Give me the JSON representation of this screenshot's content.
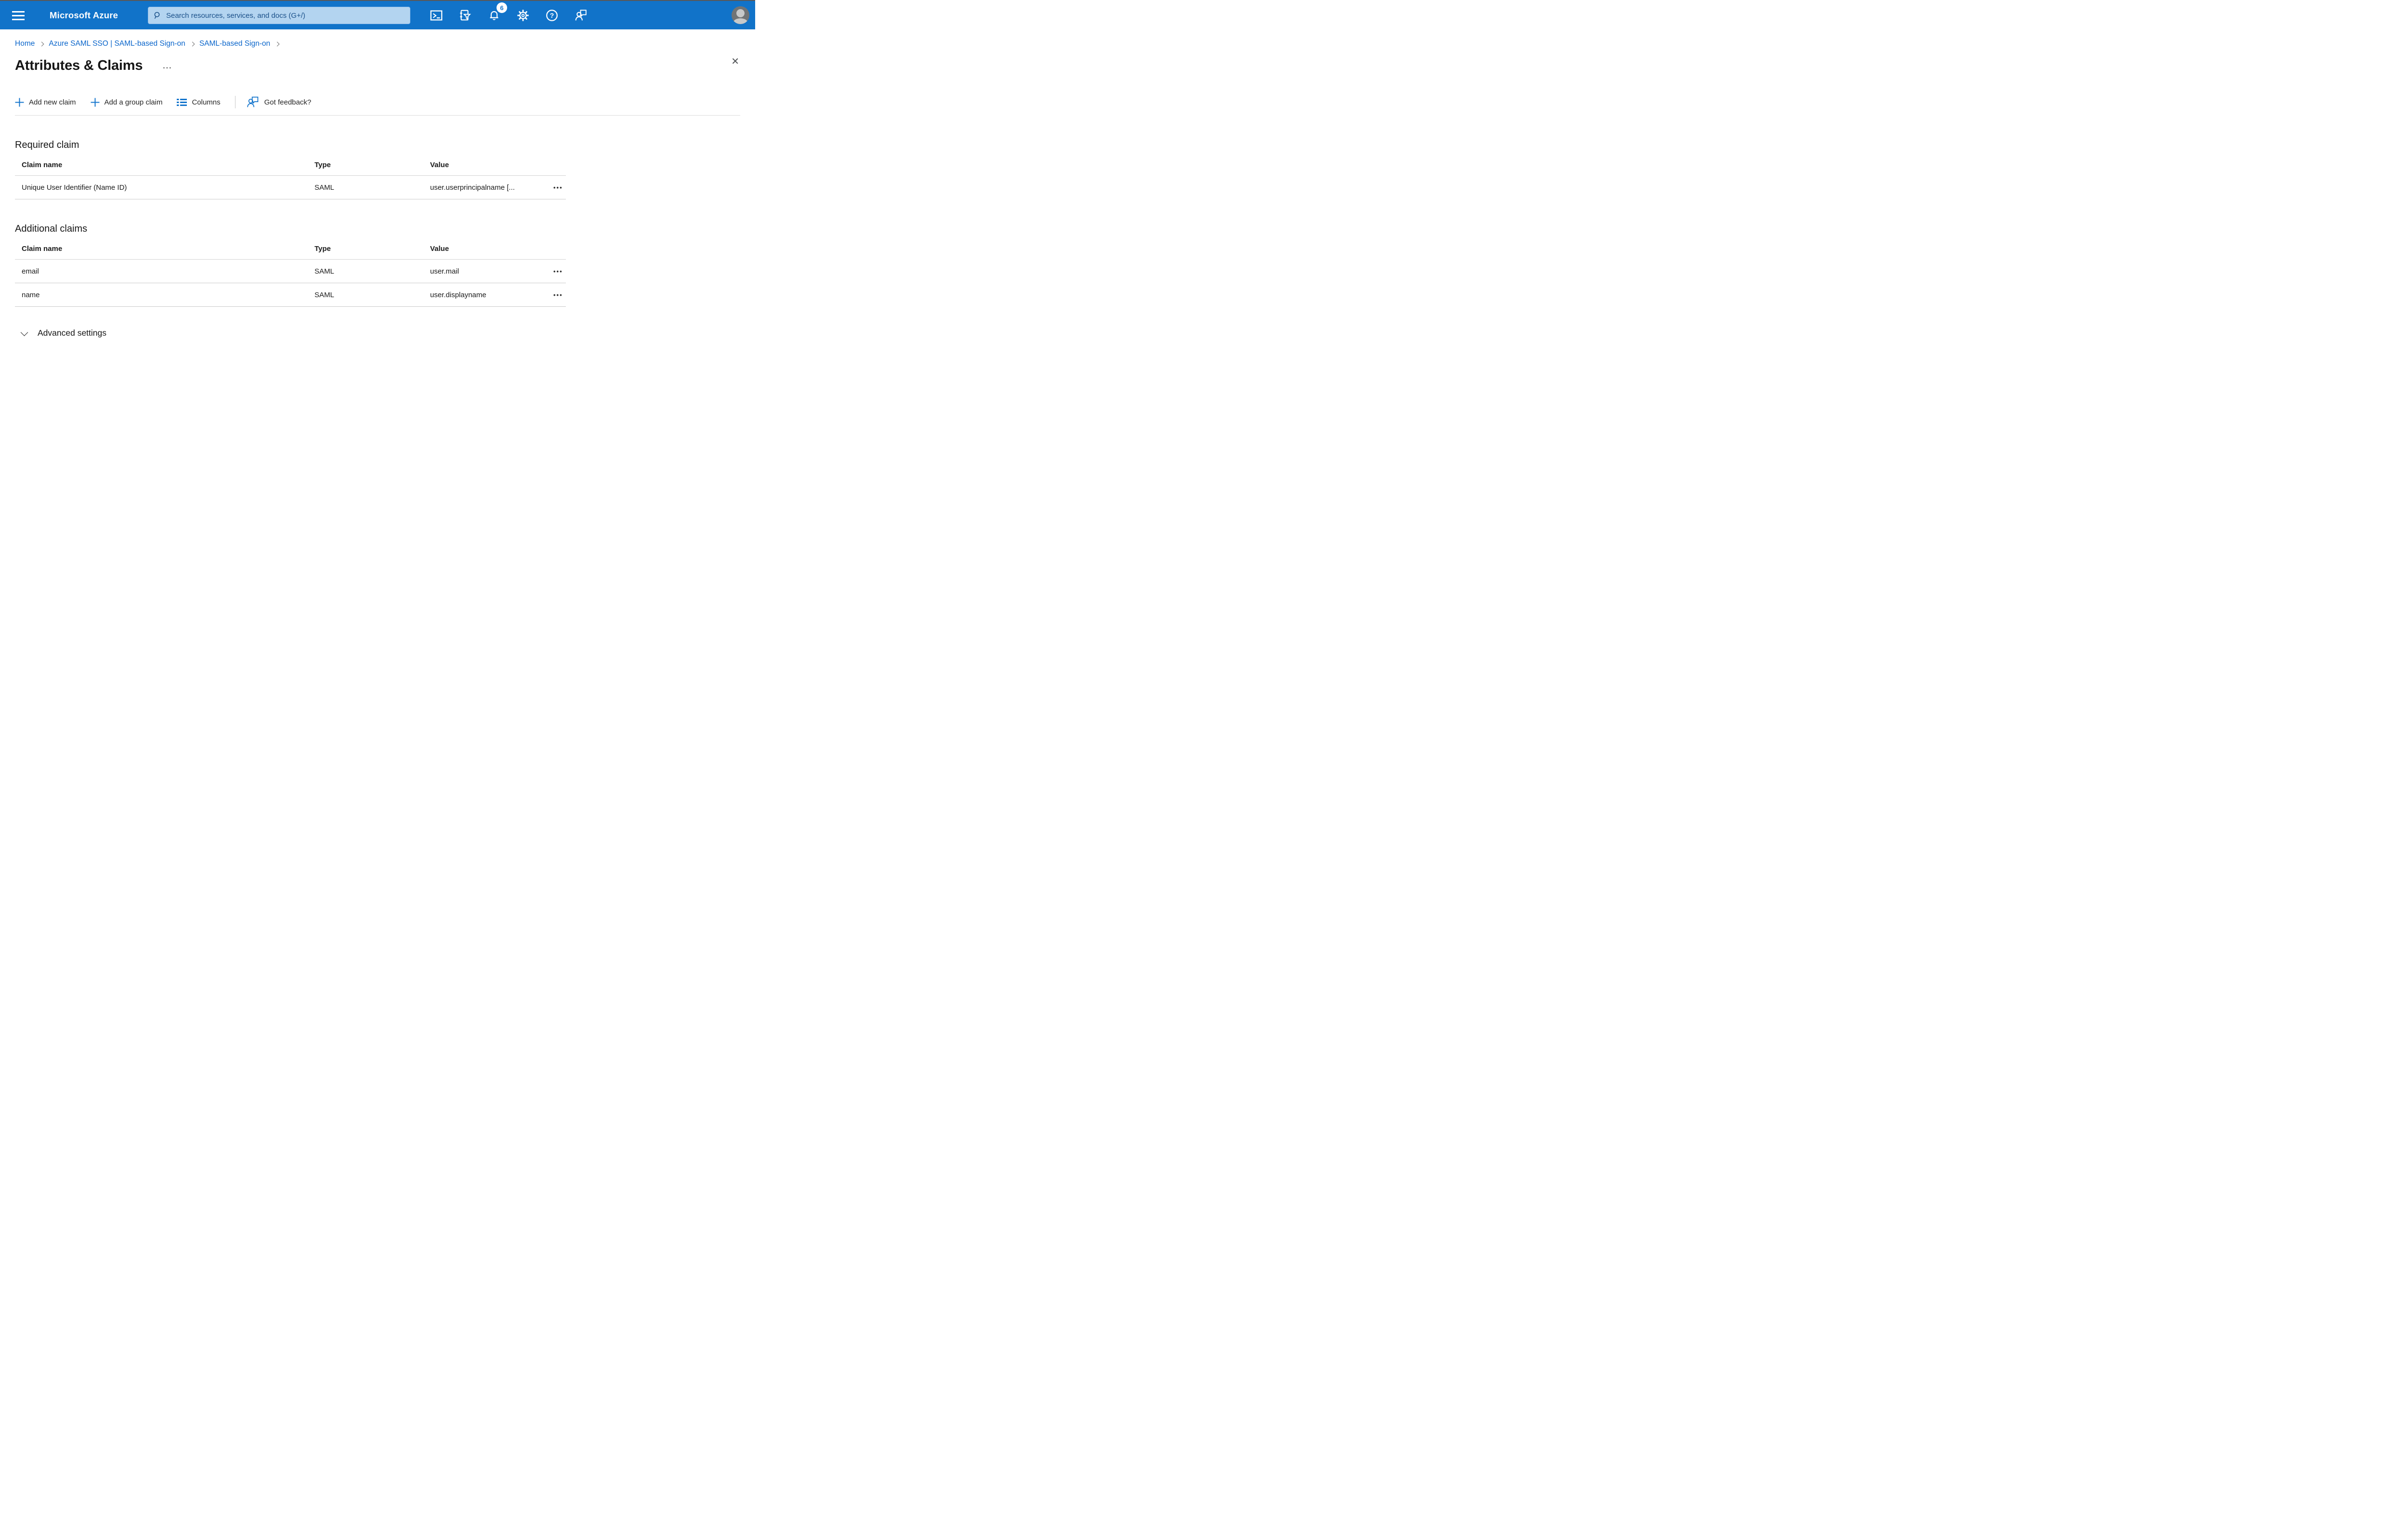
{
  "topbar": {
    "brand": "Microsoft Azure",
    "search_placeholder": "Search resources, services, and docs (G+/)",
    "notification_count": "6"
  },
  "breadcrumb": {
    "items": [
      {
        "label": "Home"
      },
      {
        "label": "Azure SAML SSO | SAML-based Sign-on"
      },
      {
        "label": "SAML-based Sign-on"
      }
    ]
  },
  "page": {
    "title": "Attributes & Claims",
    "ellipsis_glyph": "···",
    "close_glyph": "✕",
    "row_menu_glyph": "•••"
  },
  "toolbar": {
    "add_new_claim": "Add new claim",
    "add_group_claim": "Add a group claim",
    "columns": "Columns",
    "got_feedback": "Got feedback?"
  },
  "tables": {
    "required": {
      "title": "Required claim",
      "headers": [
        "Claim name",
        "Type",
        "Value"
      ],
      "rows": [
        {
          "claim": "Unique User Identifier (Name ID)",
          "type": "SAML",
          "value": "user.userprincipalname [..."
        }
      ]
    },
    "additional": {
      "title": "Additional claims",
      "headers": [
        "Claim name",
        "Type",
        "Value"
      ],
      "rows": [
        {
          "claim": "email",
          "type": "SAML",
          "value": "user.mail"
        },
        {
          "claim": "name",
          "type": "SAML",
          "value": "user.displayname"
        }
      ]
    }
  },
  "advanced": {
    "label": "Advanced settings"
  },
  "colors": {
    "topbar_blue": "#1173c9",
    "accent_blue": "#1374cc",
    "link_blue": "#0b66cb",
    "search_bg": "#b3d4f0",
    "search_text": "#1a5089"
  }
}
